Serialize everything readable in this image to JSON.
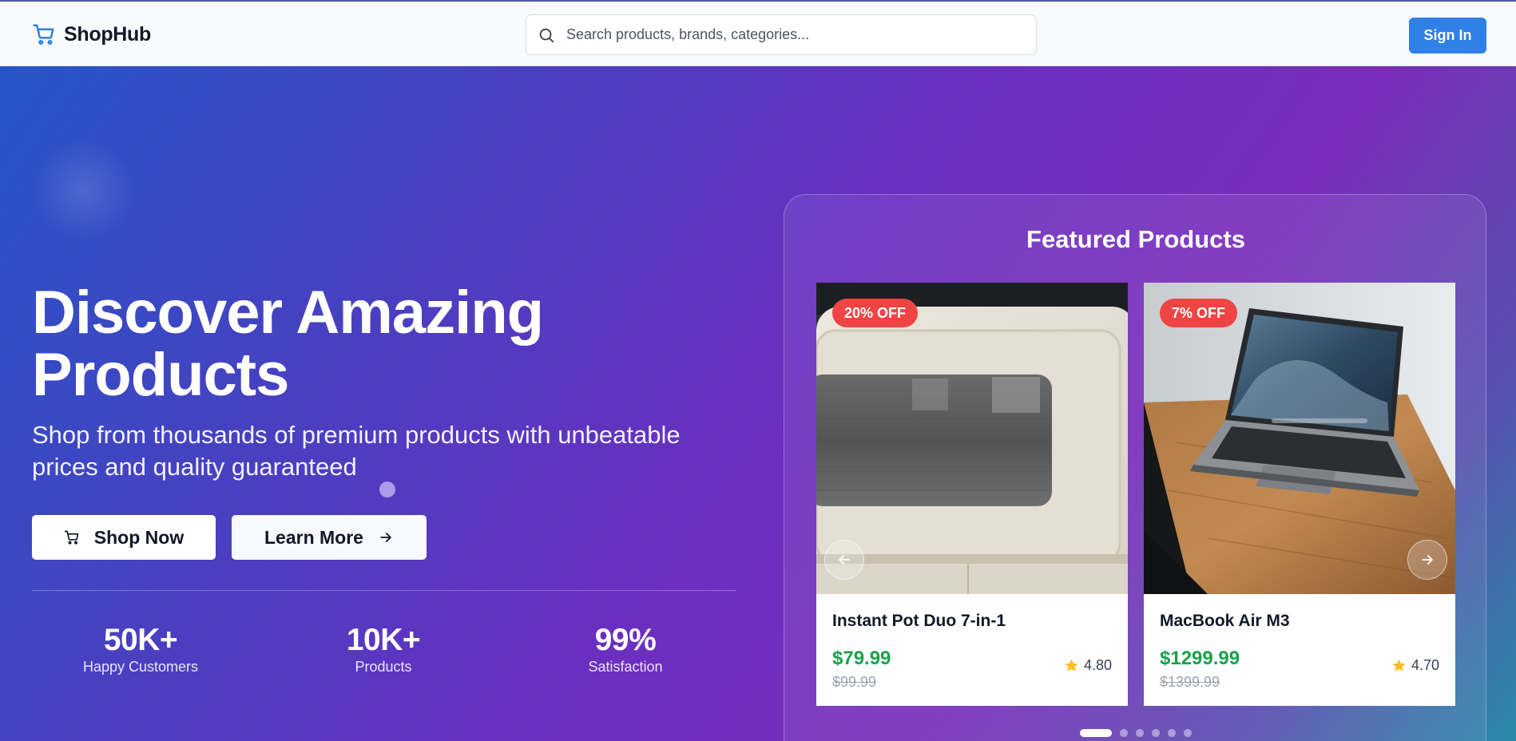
{
  "header": {
    "brand": "ShopHub",
    "search_placeholder": "Search products, brands, categories...",
    "sign_in": "Sign In"
  },
  "hero": {
    "title": "Discover Amazing Products",
    "subtitle": "Shop from thousands of premium products with unbeatable prices and quality guaranteed",
    "shop_now": "Shop Now",
    "learn_more": "Learn More",
    "stats": [
      {
        "value": "50K+",
        "label": "Happy Customers"
      },
      {
        "value": "10K+",
        "label": "Products"
      },
      {
        "value": "99%",
        "label": "Satisfaction"
      }
    ]
  },
  "featured": {
    "title": "Featured Products",
    "products": [
      {
        "name": "Instant Pot Duo 7-in-1",
        "discount": "20% OFF",
        "price": "$79.99",
        "old_price": "$99.99",
        "rating": "4.80",
        "image": "microwave-photo"
      },
      {
        "name": "MacBook Air M3",
        "discount": "7% OFF",
        "price": "$1299.99",
        "old_price": "$1399.99",
        "rating": "4.70",
        "image": "laptop-photo"
      }
    ],
    "carousel_total": 6,
    "carousel_active": 1
  },
  "colors": {
    "brand_blue": "#2f80e7",
    "price_green": "#16a34a",
    "discount_red": "#ef4444",
    "star_yellow": "#fbbf24"
  },
  "icons": [
    "cart-icon",
    "search-icon",
    "chevron-left-icon",
    "chevron-right-icon",
    "star-icon",
    "arrow-right-icon"
  ]
}
